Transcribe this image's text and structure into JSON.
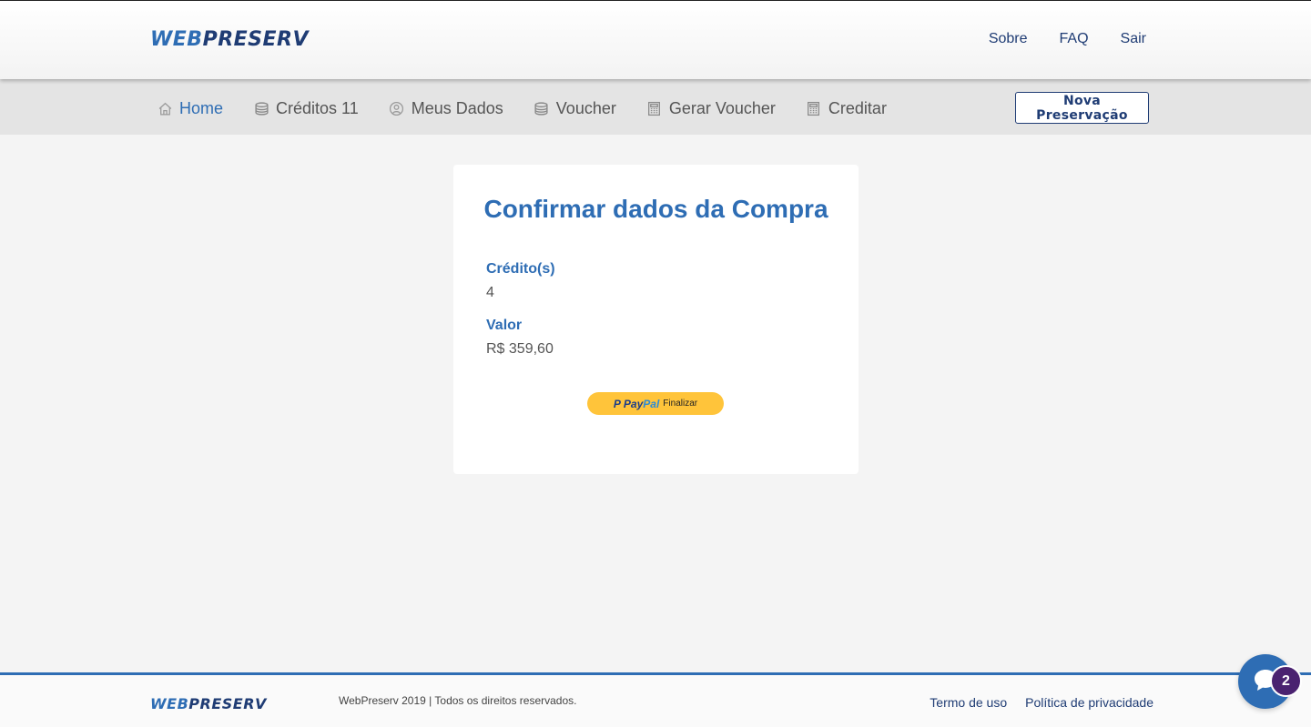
{
  "header": {
    "logo_part1": "WEB",
    "logo_part2": "PRESERV",
    "nav": {
      "sobre": "Sobre",
      "faq": "FAQ",
      "sair": "Sair"
    }
  },
  "subnav": {
    "items": [
      {
        "label": "Home",
        "icon": "home-icon",
        "active": true
      },
      {
        "label": "Créditos 11",
        "icon": "coins-icon",
        "active": false
      },
      {
        "label": "Meus Dados",
        "icon": "user-icon",
        "active": false
      },
      {
        "label": "Voucher",
        "icon": "coins-icon",
        "active": false
      },
      {
        "label": "Gerar Voucher",
        "icon": "calculator-icon",
        "active": false
      },
      {
        "label": "Creditar",
        "icon": "calculator-icon",
        "active": false
      }
    ],
    "cta_label": "Nova Preservação"
  },
  "card": {
    "title": "Confirmar dados da Compra",
    "credits_label": "Crédito(s)",
    "credits_value": "4",
    "valor_label": "Valor",
    "valor_value": "R$ 359,60",
    "paypal": {
      "brand_pay": "Pay",
      "brand_pal": "Pal",
      "action": "Finalizar"
    }
  },
  "footer": {
    "logo_part1": "WEB",
    "logo_part2": "PRESERV",
    "copyright": "WebPreserv 2019 | Todos os direitos reservados.",
    "links": {
      "termo": "Termo de uso",
      "politica": "Política de privacidade"
    }
  },
  "chat": {
    "badge_count": "2"
  },
  "colors": {
    "primary": "#2e6db4",
    "navy": "#1f3c74",
    "paypal_yellow": "#ffc43a",
    "badge": "#4a2270"
  }
}
